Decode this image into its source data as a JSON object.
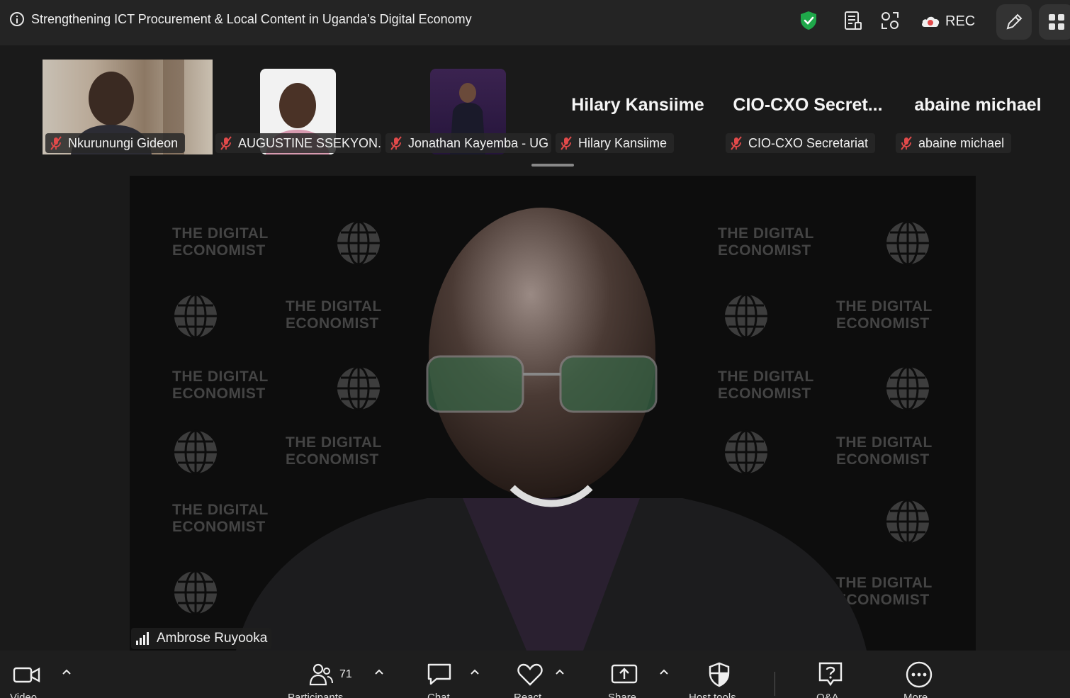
{
  "header": {
    "title": "Strengthening ICT Procurement & Local Content in Uganda’s Digital Economy",
    "rec_label": "REC",
    "security_color": "#1fa84a",
    "rec_color": "#e24a4a"
  },
  "participants": [
    {
      "name": "Nkurunungi Gideon",
      "display": "Nkurunungi Gideon",
      "muted": true,
      "video": "photo"
    },
    {
      "name": "AUGUSTINE SSEKYON...",
      "display": "AUGUSTINE SSEKYON...",
      "muted": true,
      "video": "photo"
    },
    {
      "name": "Jonathan Kayemba - UG",
      "display": "Jonathan Kayemba - UG",
      "muted": true,
      "video": "photo"
    },
    {
      "name": "Hilary Kansiime",
      "display": "Hilary Kansiime",
      "muted": true,
      "video": "name"
    },
    {
      "name": "CIO-CXO Secretariat",
      "display": "CIO-CXO  Secret...",
      "muted": true,
      "video": "name"
    },
    {
      "name": "abaine michael",
      "display": "abaine michael",
      "muted": true,
      "video": "name"
    }
  ],
  "stage": {
    "speaker": "Ambrose Ruyooka",
    "backdrop_line1": "THE DIGITAL",
    "backdrop_line2": "ECONOMIST"
  },
  "toolbar": {
    "video_label": "Video",
    "participants_label": "Participants",
    "participants_count": "71",
    "chat_label": "Chat",
    "react_label": "React",
    "share_label": "Share",
    "host_tools_label": "Host tools",
    "qa_label": "Q&A",
    "more_label": "More"
  }
}
